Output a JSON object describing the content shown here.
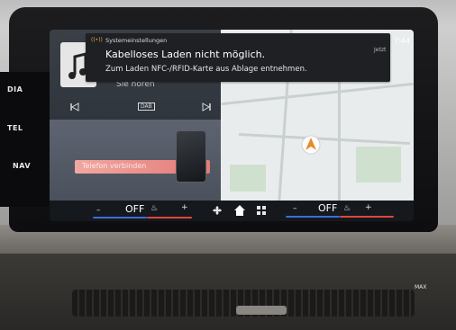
{
  "side": {
    "media": "DIA",
    "tel": "TEL",
    "nav": "NAV"
  },
  "notification": {
    "source": "Systemeinstellungen",
    "time_label": "Jetzt",
    "title": "Kabelloses Laden nicht möglich.",
    "message": "Zum Laden NFC-/RFID-Karte aus Ablage entnehmen."
  },
  "status": {
    "time": "7:44"
  },
  "media": {
    "artist_partial": "Sie hören",
    "source": "DAB",
    "prev_icon": "skip-previous-icon",
    "next_icon": "skip-next-icon",
    "art_icon": "music-note-icon"
  },
  "phone": {
    "connect_label": "Telefon verbinden"
  },
  "climate": {
    "left_minus": "–",
    "left_value": "OFF",
    "left_plus": "+",
    "right_minus": "–",
    "right_value": "OFF",
    "right_plus": "+",
    "fan_icon": "fan-icon",
    "home_icon": "home-icon",
    "apps_icon": "apps-grid-icon",
    "seat_icon": "seat-heat-icon"
  },
  "console": {
    "max_label": "MAX"
  },
  "colors": {
    "accent_blue": "#3b6fd8",
    "accent_red": "#e0473b",
    "phone_bar": "#e98a84"
  }
}
